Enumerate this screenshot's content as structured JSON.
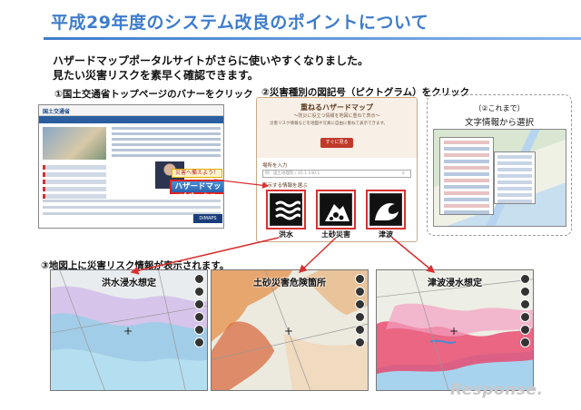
{
  "header": {
    "title": "平成29年度のシステム改良のポイントについて"
  },
  "intro": {
    "line1": "ハザードマップポータルサイトがさらに使いやすくなりました。",
    "line2": "見たい災害リスクを素早く確認できます。"
  },
  "steps": {
    "step1": "①国土交通省トップページのバナーをクリック",
    "step2": "②災害種別の図記号（ピクトグラム）をクリック",
    "step3_line1": "（②これまで）",
    "step3_line2": "文字情報から選択",
    "step4": "③地図上に災害リスク情報が表示されます。"
  },
  "mlit_page": {
    "logo": "国土交通省",
    "banner_small": "災害へ備えよう！",
    "banner_main": "ハザードマップポータル",
    "badge": "DiMAPS"
  },
  "portal": {
    "title": "重ねるハザードマップ",
    "subtitle": "～防災に役立つ情報を地図に重ねて表示～",
    "description": "災害リスク情報などを地図や写真に自由に重ねて表示できます。",
    "button": "すぐに見る",
    "search_label": "場所を入力",
    "search_placeholder": "例：国土地理院 / 35.1 140.1",
    "info_label": "表示する情報を選ぶ",
    "pictograms": [
      {
        "label": "洪水",
        "icon": "flood-icon"
      },
      {
        "label": "土砂災害",
        "icon": "landslide-icon"
      },
      {
        "label": "津波",
        "icon": "tsunami-icon"
      }
    ]
  },
  "maps": [
    {
      "title": "洪水浸水想定",
      "accent": "#c9a4e8"
    },
    {
      "title": "土砂災害危険箇所",
      "accent": "#e59a5a"
    },
    {
      "title": "津波浸水想定",
      "accent": "#e8446a"
    }
  ],
  "colors": {
    "title": "#3f7ccc",
    "highlight": "#d83030"
  },
  "watermark": "Response."
}
